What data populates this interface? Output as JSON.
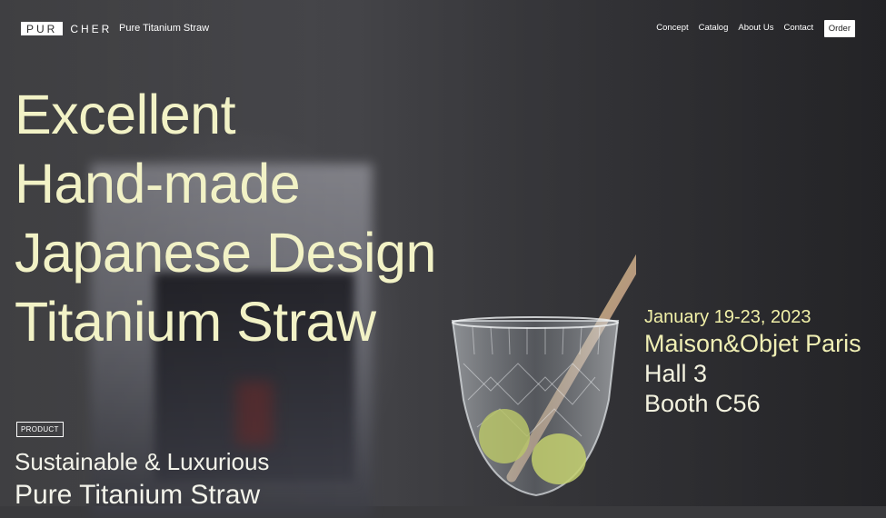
{
  "header": {
    "logo_box": "PUR",
    "logo_rest": "CHER",
    "tagline": "Pure Titanium Straw",
    "nav": [
      "Concept",
      "Catalog",
      "About Us",
      "Contact"
    ],
    "order_label": "Order"
  },
  "hero": {
    "headline": [
      "Excellent",
      "Hand-made",
      "Japanese Design",
      "Titanium Straw"
    ]
  },
  "event": {
    "date": "January 19-23, 2023",
    "name": "Maison&Objet Paris",
    "hall": "Hall 3",
    "booth": "Booth C56"
  },
  "product": {
    "badge": "PRODUCT",
    "subtitle": "Sustainable & Luxurious",
    "title": "Pure Titanium Straw"
  },
  "colors": {
    "headline": "#f2f2c6",
    "event_accent": "#f1f0a8",
    "background": "#3a3a3d"
  }
}
